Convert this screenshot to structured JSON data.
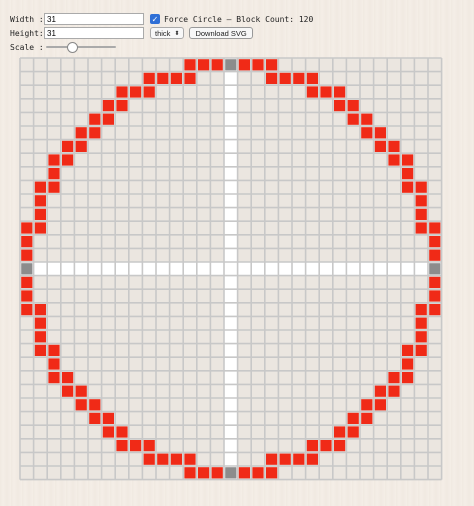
{
  "controls": {
    "width_label": "Width :",
    "width_value": "31",
    "height_label": "Height:",
    "height_value": "31",
    "force_circle_label": "Force Circle — Block Count: 120",
    "force_circle_checked": true,
    "thickness_value": "thick",
    "download_label": "Download SVG",
    "scale_label": "Scale :",
    "scale_level": 0.35
  },
  "grid": {
    "cols": 31,
    "rows": 31,
    "colors": {
      "block": "#f02a17",
      "center_block": "#8c8c8c",
      "line": "#c8c8c8",
      "axis": "#ffffff"
    }
  }
}
